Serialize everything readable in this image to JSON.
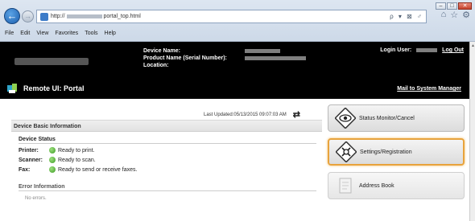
{
  "browser": {
    "address_prefix": "http://",
    "address_suffix": "portal_top.html",
    "address_tools": "ρ ▾ ⊠ ♂",
    "menu": [
      "File",
      "Edit",
      "View",
      "Favorites",
      "Tools",
      "Help"
    ]
  },
  "header": {
    "device_name_label": "Device Name:",
    "product_name_label": "Product Name (Serial Number):",
    "location_label": "Location:",
    "login_user_label": "Login User:",
    "log_out": "Log Out",
    "title": "Remote UI: Portal",
    "mail_link": "Mail to System Manager"
  },
  "content": {
    "last_updated": "Last Updated:05/13/2015 09:07:03 AM",
    "panel_title": "Device Basic Information",
    "device_status_title": "Device Status",
    "status": [
      {
        "label": "Printer:",
        "value": "Ready to print."
      },
      {
        "label": "Scanner:",
        "value": "Ready to scan."
      },
      {
        "label": "Fax:",
        "value": "Ready to send or receive faxes."
      }
    ],
    "error_title": "Error Information",
    "error_text": "No errors."
  },
  "side_buttons": {
    "status_monitor": "Status Monitor/Cancel",
    "settings": "Settings/Registration",
    "address_book": "Address Book"
  },
  "colors": {
    "header_bg": "#000000",
    "selected_outline": "#e8a33c",
    "status_ok": "#3c9b25"
  }
}
